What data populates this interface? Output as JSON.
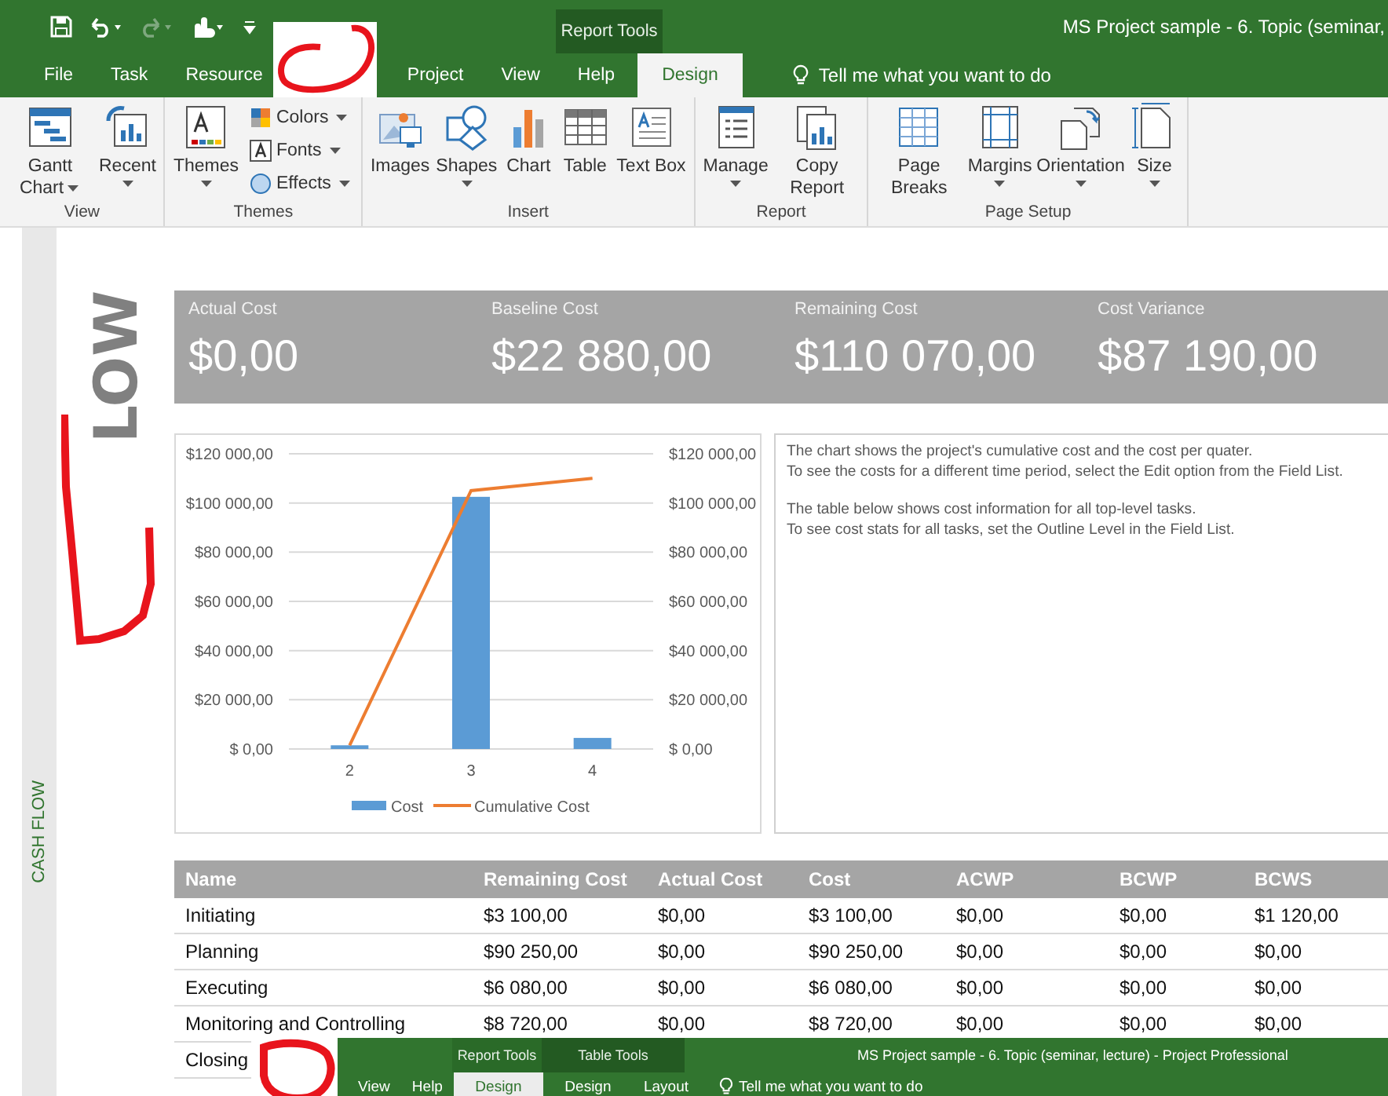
{
  "title_bar": {
    "title": "MS Project sample - 6. Topic (seminar,",
    "contextual_label": "Report Tools"
  },
  "tabs": [
    {
      "label": "File",
      "selected": false
    },
    {
      "label": "Task",
      "selected": false
    },
    {
      "label": "Resource",
      "selected": false
    },
    {
      "label": "Project",
      "selected": false
    },
    {
      "label": "View",
      "selected": false
    },
    {
      "label": "Help",
      "selected": false
    },
    {
      "label": "Design",
      "selected": true
    }
  ],
  "tell_me": "Tell me what you want to do",
  "ribbon_groups": [
    {
      "label": "View",
      "buttons": [
        {
          "kind": "large",
          "label": "Gantt Chart",
          "dropdown": true
        },
        {
          "kind": "large",
          "label": "Recent",
          "dropdown": true
        }
      ]
    },
    {
      "label": "Themes",
      "buttons": [
        {
          "kind": "large",
          "label": "Themes",
          "dropdown": true
        },
        {
          "kind": "stack",
          "items": [
            {
              "label": "Colors",
              "dropdown": true
            },
            {
              "label": "Fonts",
              "dropdown": true
            },
            {
              "label": "Effects",
              "dropdown": true
            }
          ]
        }
      ]
    },
    {
      "label": "Insert",
      "buttons": [
        {
          "kind": "large",
          "label": "Images"
        },
        {
          "kind": "large",
          "label": "Shapes",
          "dropdown": true
        },
        {
          "kind": "large",
          "label": "Chart"
        },
        {
          "kind": "large",
          "label": "Table"
        },
        {
          "kind": "large",
          "label": "Text Box"
        }
      ]
    },
    {
      "label": "Report",
      "buttons": [
        {
          "kind": "large",
          "label": "Manage",
          "dropdown": true
        },
        {
          "kind": "large",
          "label": "Copy Report"
        }
      ]
    },
    {
      "label": "Page Setup",
      "buttons": [
        {
          "kind": "large",
          "label": "Page Breaks"
        },
        {
          "kind": "large",
          "label": "Margins",
          "dropdown": true
        },
        {
          "kind": "large",
          "label": "Orientation",
          "dropdown": true
        },
        {
          "kind": "large",
          "label": "Size",
          "dropdown": true
        }
      ]
    }
  ],
  "side_label": "CASH FLOW",
  "report_title": "LOW",
  "kpis": [
    {
      "label": "Actual Cost",
      "value": "$0,00"
    },
    {
      "label": "Baseline Cost",
      "value": "$22 880,00"
    },
    {
      "label": "Remaining Cost",
      "value": "$110 070,00"
    },
    {
      "label": "Cost Variance",
      "value": "$87 190,00"
    }
  ],
  "chart": {
    "chart_data": {
      "type": "bar",
      "categories": [
        "2",
        "3",
        "4"
      ],
      "series": [
        {
          "name": "Cost",
          "color": "#5b9bd5",
          "type": "bar",
          "values": [
            1500,
            102500,
            4500
          ]
        },
        {
          "name": "Cumulative Cost",
          "color": "#ed7d31",
          "type": "line",
          "values": [
            1500,
            105000,
            110000
          ]
        }
      ],
      "ylim": [
        0,
        120000
      ],
      "grid": true,
      "legend": true,
      "yticks": [
        {
          "value": 0,
          "label": "$ 0,00"
        },
        {
          "value": 20000,
          "label": "$20 000,00"
        },
        {
          "value": 40000,
          "label": "$40 000,00"
        },
        {
          "value": 60000,
          "label": "$60 000,00"
        },
        {
          "value": 80000,
          "label": "$80 000,00"
        },
        {
          "value": 100000,
          "label": "$100 000,00"
        },
        {
          "value": 120000,
          "label": "$120 000,00"
        }
      ]
    }
  },
  "description": [
    "The chart shows the project's cumulative cost and the cost per quater.",
    "To see the costs for a different time period, select the Edit option from the Field List.",
    "The table below shows cost information for all top-level tasks.",
    "To see cost stats for all tasks, set the Outline Level in the Field List."
  ],
  "table": {
    "columns": [
      "Name",
      "Remaining Cost",
      "Actual Cost",
      "Cost",
      "ACWP",
      "BCWP",
      "BCWS"
    ],
    "rows": [
      [
        "Initiating",
        "$3 100,00",
        "$0,00",
        "$3 100,00",
        "$0,00",
        "$0,00",
        "$1 120,00"
      ],
      [
        "Planning",
        "$90 250,00",
        "$0,00",
        "$90 250,00",
        "$0,00",
        "$0,00",
        "$0,00"
      ],
      [
        "Executing",
        "$6 080,00",
        "$0,00",
        "$6 080,00",
        "$0,00",
        "$0,00",
        "$0,00"
      ],
      [
        "Monitoring and Controlling",
        "$8 720,00",
        "$0,00",
        "$8 720,00",
        "$0,00",
        "$0,00",
        "$0,00"
      ],
      [
        "Closing"
      ]
    ]
  },
  "overlay_window": {
    "title": "MS Project sample - 6. Topic (seminar, lecture)  -  Project Professional",
    "contextual_tabs": [
      "Report Tools",
      "Table Tools"
    ],
    "tabs": [
      {
        "label": "View",
        "selected": false
      },
      {
        "label": "Help",
        "selected": false
      },
      {
        "label": "Design",
        "selected": true
      },
      {
        "label": "Design",
        "selected": false
      },
      {
        "label": "Layout",
        "selected": false
      }
    ],
    "tell_me": "Tell me what you want to do"
  }
}
